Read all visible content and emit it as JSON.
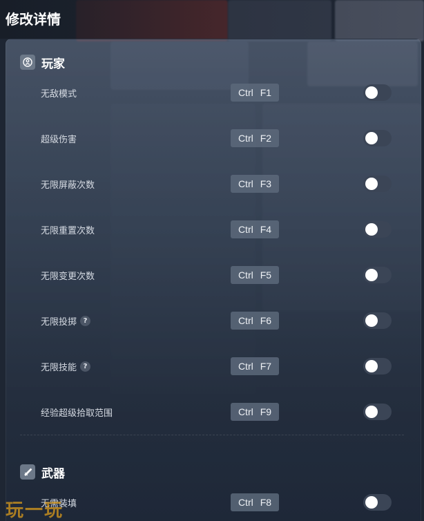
{
  "header": {
    "title": "修改详情"
  },
  "sections": [
    {
      "title": "玩家",
      "icon": "player-icon",
      "rows": [
        {
          "label": "无敌模式",
          "hotkey": [
            "Ctrl",
            "F1"
          ],
          "help": false,
          "enabled": false
        },
        {
          "label": "超级伤害",
          "hotkey": [
            "Ctrl",
            "F2"
          ],
          "help": false,
          "enabled": false
        },
        {
          "label": "无限屏蔽次数",
          "hotkey": [
            "Ctrl",
            "F3"
          ],
          "help": false,
          "enabled": false
        },
        {
          "label": "无限重置次数",
          "hotkey": [
            "Ctrl",
            "F4"
          ],
          "help": false,
          "enabled": false
        },
        {
          "label": "无限变更次数",
          "hotkey": [
            "Ctrl",
            "F5"
          ],
          "help": false,
          "enabled": false
        },
        {
          "label": "无限投掷",
          "hotkey": [
            "Ctrl",
            "F6"
          ],
          "help": true,
          "enabled": false
        },
        {
          "label": "无限技能",
          "hotkey": [
            "Ctrl",
            "F7"
          ],
          "help": true,
          "enabled": false
        },
        {
          "label": "经验超级拾取范围",
          "hotkey": [
            "Ctrl",
            "F9"
          ],
          "help": false,
          "enabled": false
        }
      ]
    },
    {
      "title": "武器",
      "icon": "weapon-icon",
      "rows": [
        {
          "label": "无需装填",
          "hotkey": [
            "Ctrl",
            "F8"
          ],
          "help": false,
          "enabled": false
        }
      ]
    }
  ],
  "help_glyph": "?",
  "watermark": "玩一玩",
  "colors": {
    "toggle_off": "#3b4556",
    "hotkey_bg": "#5c687a",
    "watermark": "#e5a21a"
  }
}
